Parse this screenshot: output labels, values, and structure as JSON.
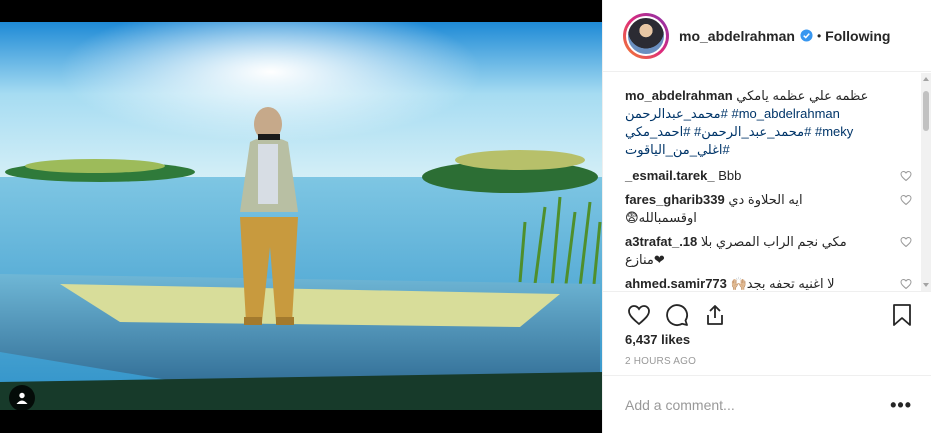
{
  "post": {
    "username": "mo_abdelrahman",
    "follow_status": "Following",
    "separator": "•",
    "caption": {
      "author": "mo_abdelrahman",
      "text": "عظمه علي عظمه يامكي",
      "hashtags_line1": "محمد_عبدالرحمن# #mo_abdelrahman",
      "hashtags_line2": "محمد_عبد_الرحمن# #احمد_مكي# #meky",
      "hashtags_line3": "اغلي_من_الياقوت#"
    },
    "comments": [
      {
        "user": "_esmail.tarek_",
        "text": "Bbb"
      },
      {
        "user": "fares_gharib339",
        "text": "ايه الحلاوة دي",
        "text2": "😨اوقسمبالله"
      },
      {
        "user": "a3trafat_.18",
        "text": "مكي نجم الراب المصري بلا",
        "text2": "منازع❤"
      },
      {
        "user": "ahmed.samir773",
        "text": "🙌🏼لا اغنيه تحفه بجد"
      }
    ],
    "likes": "6,437 likes",
    "time_ago": "2 HOURS AGO",
    "add_comment_placeholder": "Add a comment...",
    "more_label": "•••"
  },
  "icons": {
    "verified": "verified-badge-icon",
    "like": "heart-icon",
    "comment": "comment-bubble-icon",
    "share": "share-icon",
    "save": "bookmark-icon",
    "tag": "user-tag-icon"
  },
  "colors": {
    "link": "#003569",
    "verified": "#3897f0",
    "border": "#efefef",
    "muted": "#999999"
  }
}
